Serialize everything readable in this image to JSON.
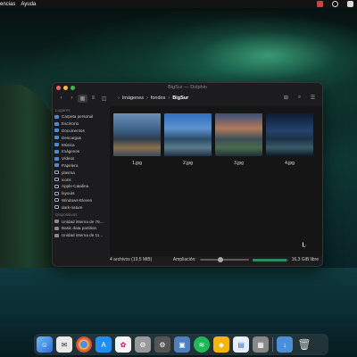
{
  "menubar": {
    "items": [
      "encias",
      "Ayuda"
    ]
  },
  "window": {
    "title": "BigSur — Dolphin",
    "breadcrumb": [
      "Imágenes",
      "fondos",
      "BigSur"
    ]
  },
  "sidebar": {
    "places_label": "Lugares",
    "places": [
      "Carpeta personal",
      "Escritorio",
      "Documentos",
      "Descargas",
      "Música",
      "Imágenes",
      "Vídeos",
      "Papelera",
      "plasma",
      "icons",
      "Apple-Catalina",
      "layouts",
      "Windows-Eleven",
      "dark-nature"
    ],
    "devices_label": "Dispositivos",
    "devices": [
      "Unidad interna de 79....",
      "Basic data partition",
      "Unidad interna de 11..."
    ]
  },
  "files": [
    {
      "name": "1.jpg"
    },
    {
      "name": "2.jpg"
    },
    {
      "name": "3.jpg"
    },
    {
      "name": "4.jpg"
    }
  ],
  "status": {
    "summary": "4 archivos (19,5 MiB)",
    "zoom_label": "Ampliación:",
    "zoom_level": 0.42,
    "free_space": "16,3 GiB libre",
    "used_fraction": 0.95
  },
  "dock": {
    "icons": [
      "finder-icon",
      "chat-icon",
      "chrome-icon",
      "app-store-icon",
      "photos-icon",
      "settings-icon",
      "system-prefs-icon",
      "image-viewer-icon",
      "spotify-icon",
      "sketch-icon",
      "document-icon",
      "calculator-icon",
      "downloads-folder-icon",
      "trash-icon"
    ]
  }
}
